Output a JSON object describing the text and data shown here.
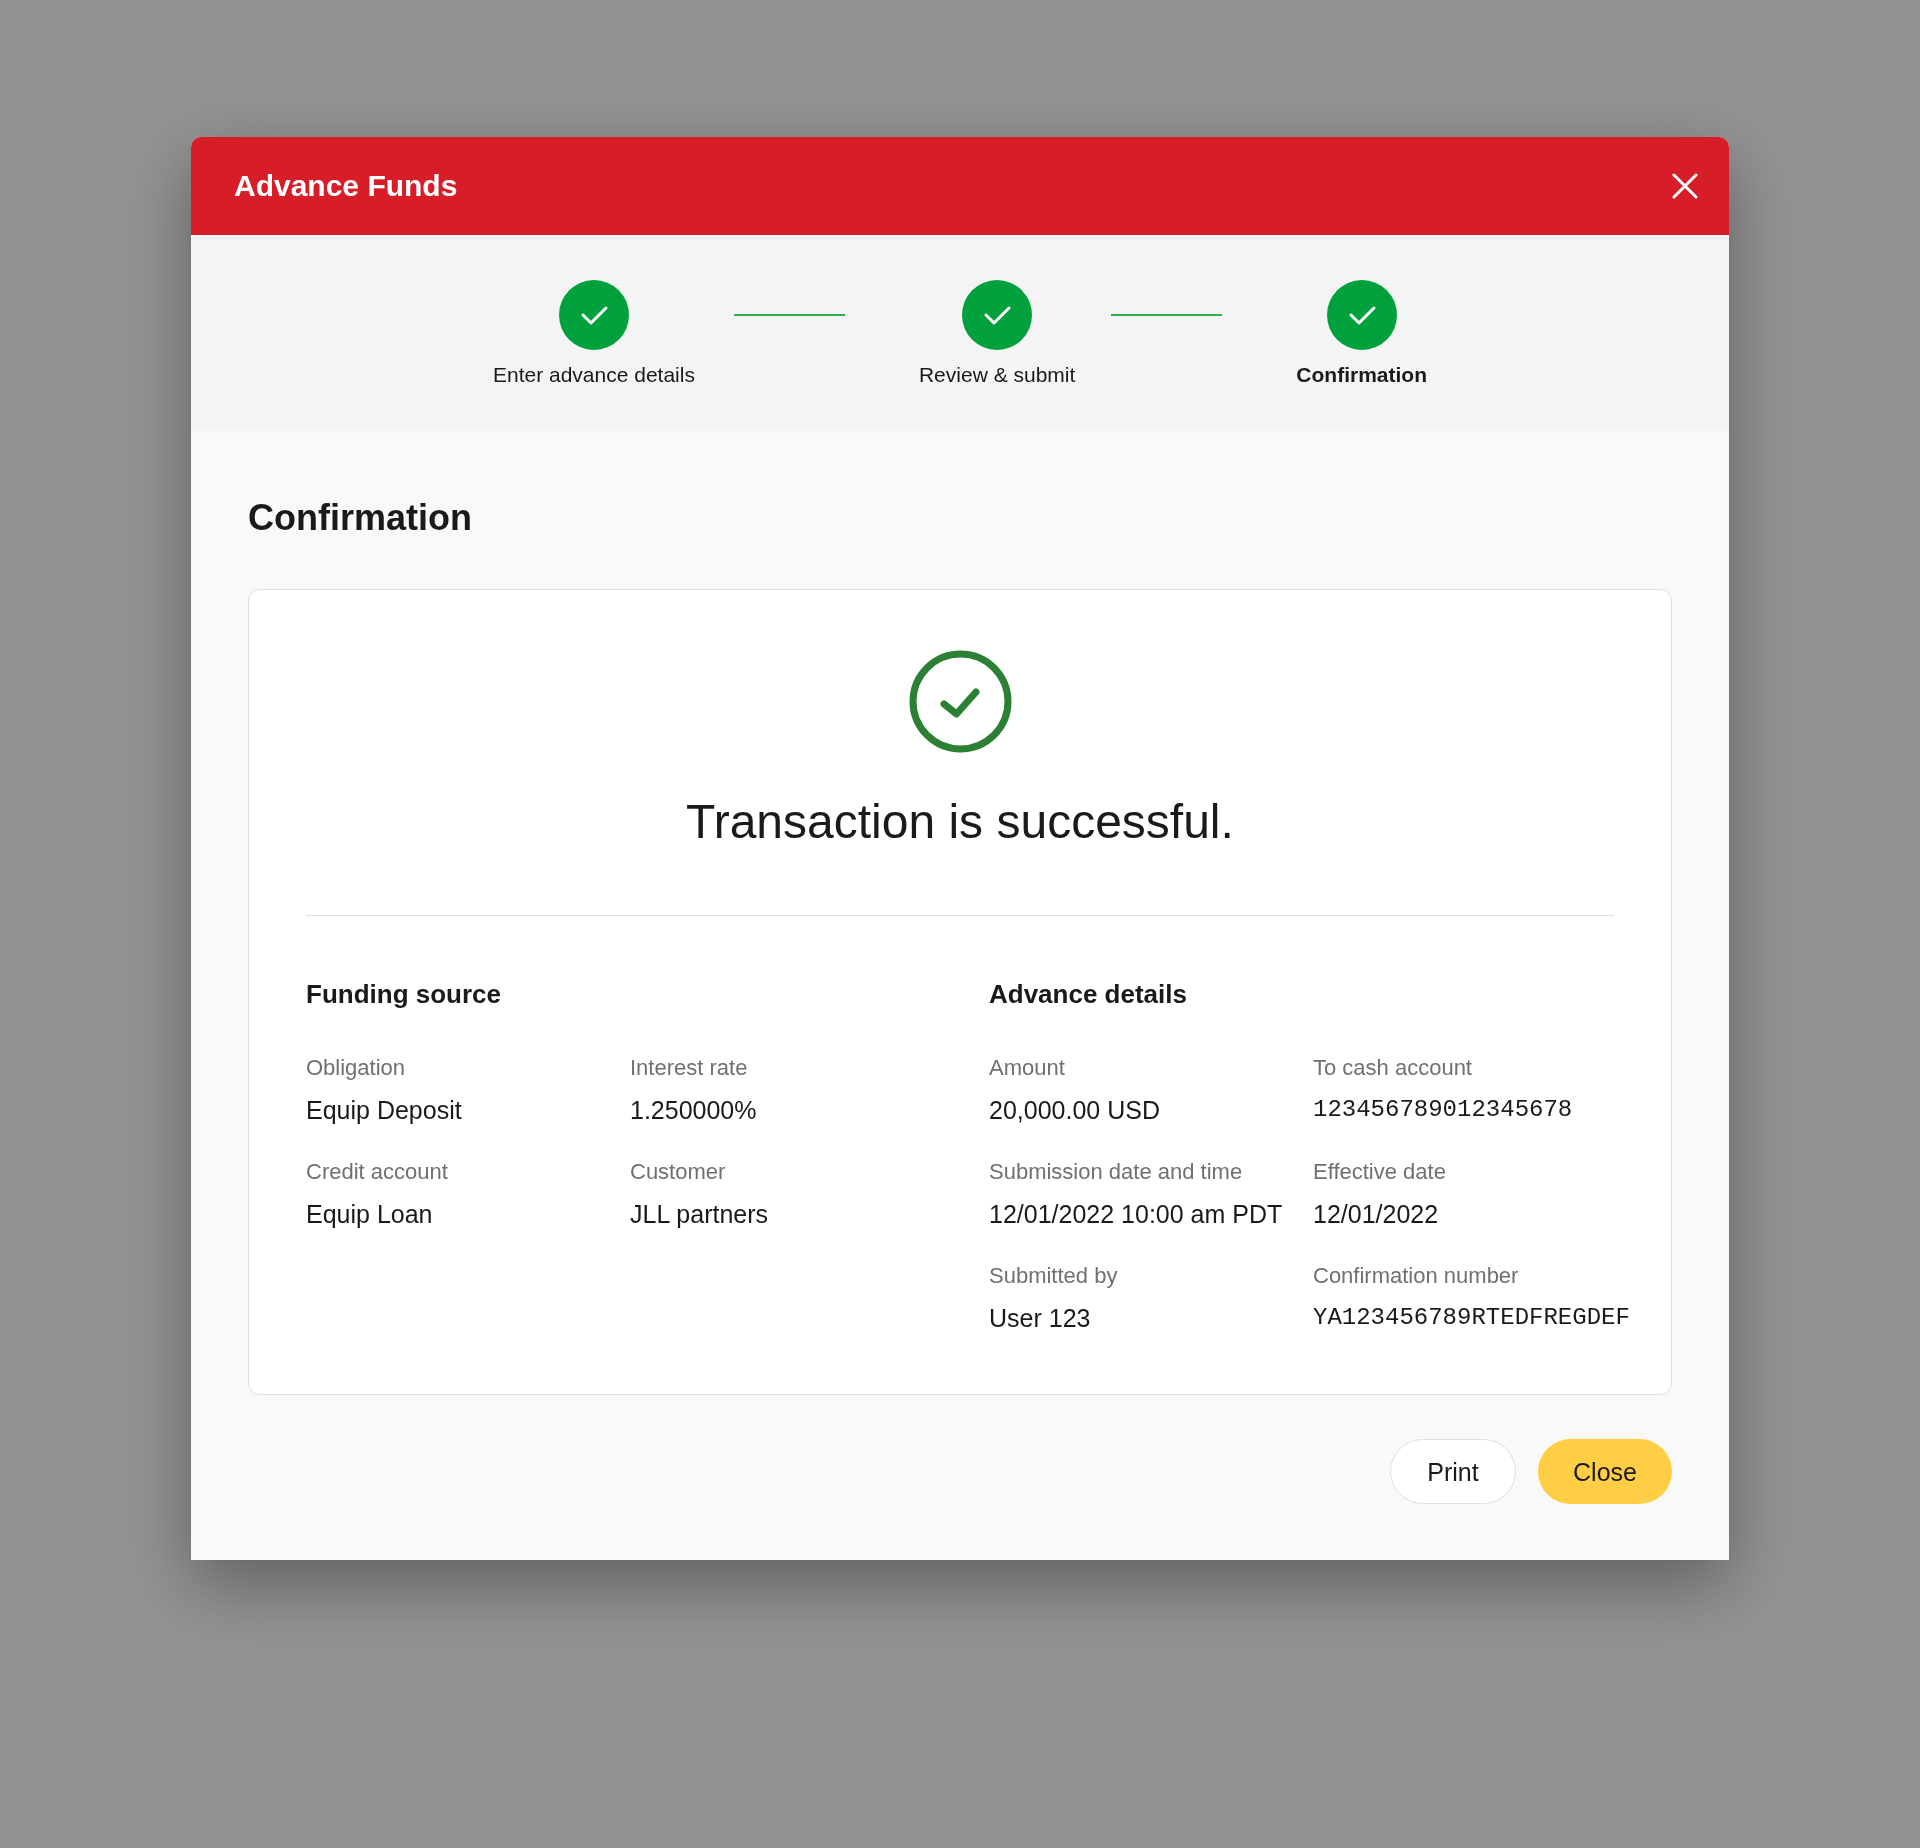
{
  "dialog": {
    "title": "Advance Funds"
  },
  "stepper": [
    {
      "label": "Enter advance details",
      "completed": true,
      "selected": false
    },
    {
      "label": "Review & submit",
      "completed": true,
      "selected": false
    },
    {
      "label": "Confirmation",
      "completed": true,
      "selected": true
    }
  ],
  "page_heading": "Confirmation",
  "result": {
    "message": "Transaction is successful."
  },
  "sections": [
    {
      "title": "Funding source",
      "fields": [
        {
          "label": "Obligation",
          "value": "Equip Deposit",
          "kind": "text"
        },
        {
          "label": "Interest rate",
          "value": "1.250000%",
          "kind": "text"
        },
        {
          "label": "Credit account",
          "value": "Equip Loan",
          "kind": "text"
        },
        {
          "label": "Customer",
          "value": "JLL partners",
          "kind": "text"
        }
      ]
    },
    {
      "title": "Advance details",
      "fields": [
        {
          "label": "Amount",
          "value": "20,000.00 USD",
          "kind": "text"
        },
        {
          "label": "To cash account",
          "value": "123456789012345678",
          "kind": "mono"
        },
        {
          "label": "Submission date and time",
          "value": "12/01/2022 10:00 am PDT",
          "kind": "text"
        },
        {
          "label": "Effective date",
          "value": "12/01/2022",
          "kind": "text"
        },
        {
          "label": "Submitted by",
          "value": "User 123",
          "kind": "text"
        },
        {
          "label": "Confirmation number",
          "value": "YA123456789RTEDFREGDEF",
          "kind": "mono"
        }
      ]
    }
  ],
  "buttons": [
    {
      "label": "Print",
      "kind": "secondary"
    },
    {
      "label": "Close",
      "kind": "primary"
    }
  ]
}
